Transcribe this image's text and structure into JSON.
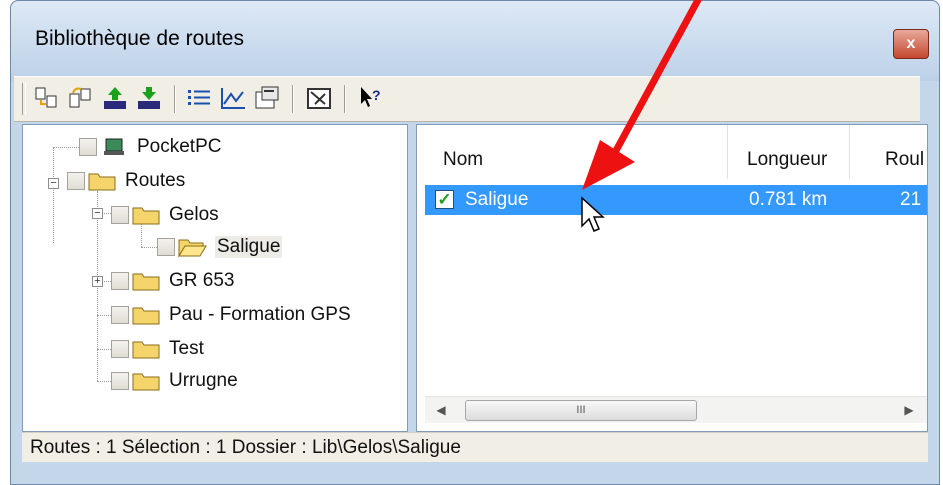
{
  "window": {
    "title": "Bibliothèque de routes",
    "close_glyph": "x"
  },
  "toolbar": {
    "buttons": [
      "copy-route-icon",
      "move-route-icon",
      "upload-icon",
      "download-icon",
      "list-view-icon",
      "profile-chart-icon",
      "properties-icon",
      "map-view-icon",
      "help-pointer-icon"
    ]
  },
  "tree": {
    "items": [
      {
        "label": "PocketPC",
        "icon": "device-icon"
      },
      {
        "label": "Routes",
        "icon": "folder-icon"
      },
      {
        "label": "Gelos",
        "icon": "folder-icon"
      },
      {
        "label": "Saligue",
        "icon": "folder-open-icon"
      },
      {
        "label": "GR 653",
        "icon": "folder-icon"
      },
      {
        "label": "Pau - Formation GPS",
        "icon": "folder-icon"
      },
      {
        "label": "Test",
        "icon": "folder-icon"
      },
      {
        "label": "Urrugne",
        "icon": "folder-icon"
      }
    ]
  },
  "list": {
    "columns": [
      "Nom",
      "Longueur",
      "Roul"
    ],
    "rows": [
      {
        "name": "Saligue",
        "length": "0.781 km",
        "extra": "21",
        "checked": true
      }
    ],
    "scroll_thumb_grip": "III"
  },
  "status": {
    "text": "Routes : 1 Sélection : 1 Dossier : Lib\\Gelos\\Saligue"
  },
  "colors": {
    "selection": "#3399ff",
    "annotation_arrow": "#ee1111",
    "folder": "#f5d56b"
  }
}
